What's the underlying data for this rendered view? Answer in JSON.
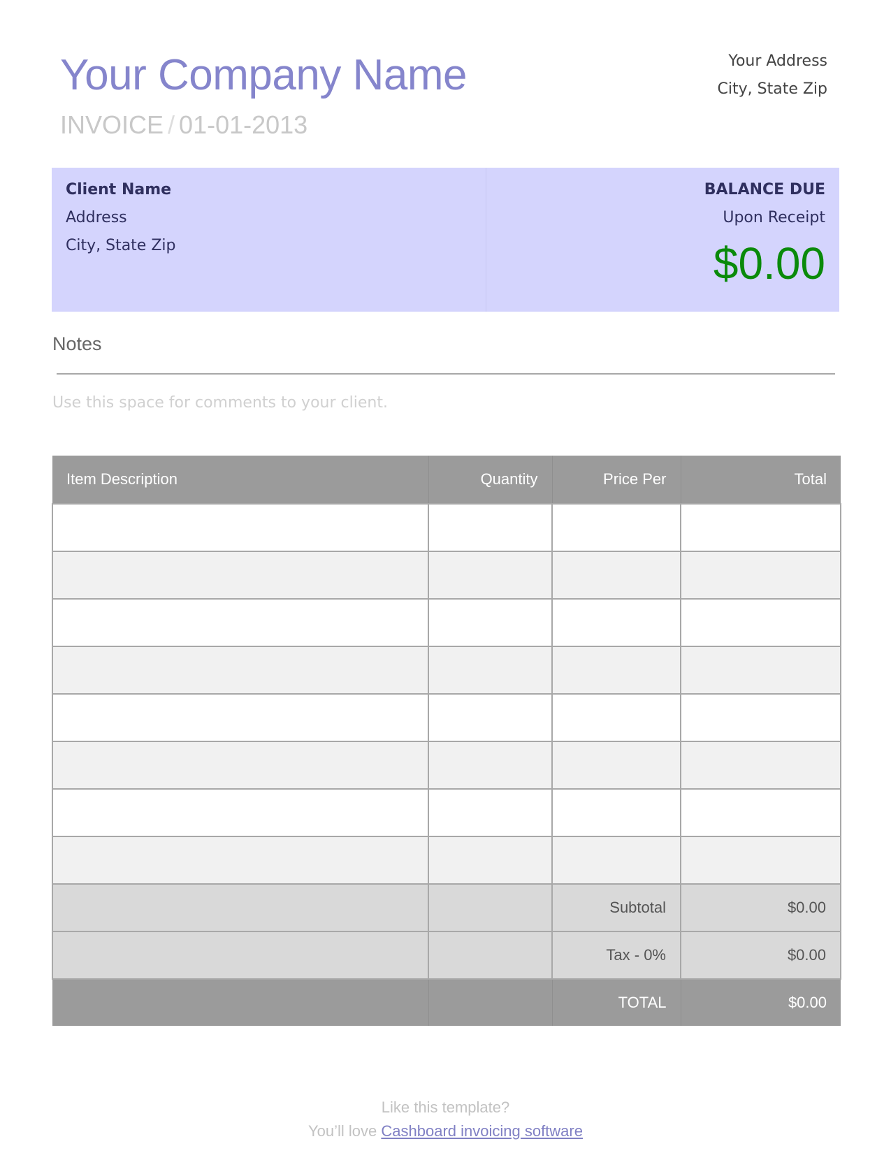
{
  "header": {
    "company_name": "Your Company Name",
    "doc_label": "INVOICE",
    "separator": "/",
    "date": "01-01-2013",
    "sender_address": "Your Address",
    "sender_city": "City, State Zip"
  },
  "client": {
    "name": "Client Name",
    "address": "Address",
    "city": "City, State Zip"
  },
  "balance": {
    "label": "BALANCE DUE",
    "terms": "Upon Receipt",
    "amount": "$0.00"
  },
  "notes": {
    "title": "Notes",
    "placeholder": "Use this space for comments to your client."
  },
  "table": {
    "headers": [
      "Item Description",
      "Quantity",
      "Price Per",
      "Total"
    ],
    "empty_rows": 8,
    "subtotal_label": "Subtotal",
    "subtotal_value": "$0.00",
    "tax_label": "Tax - 0%",
    "tax_value": "$0.00",
    "total_label": "TOTAL",
    "total_value": "$0.00"
  },
  "footer": {
    "line1": "Like this template?",
    "line2_prefix": "You’ll love ",
    "link_text": "Cashboard invoicing software"
  },
  "colors": {
    "company": "#8585cc",
    "client_box": "#d4d4fd",
    "balance_amount": "#0a8a0a",
    "table_header": "#9b9b9b"
  }
}
